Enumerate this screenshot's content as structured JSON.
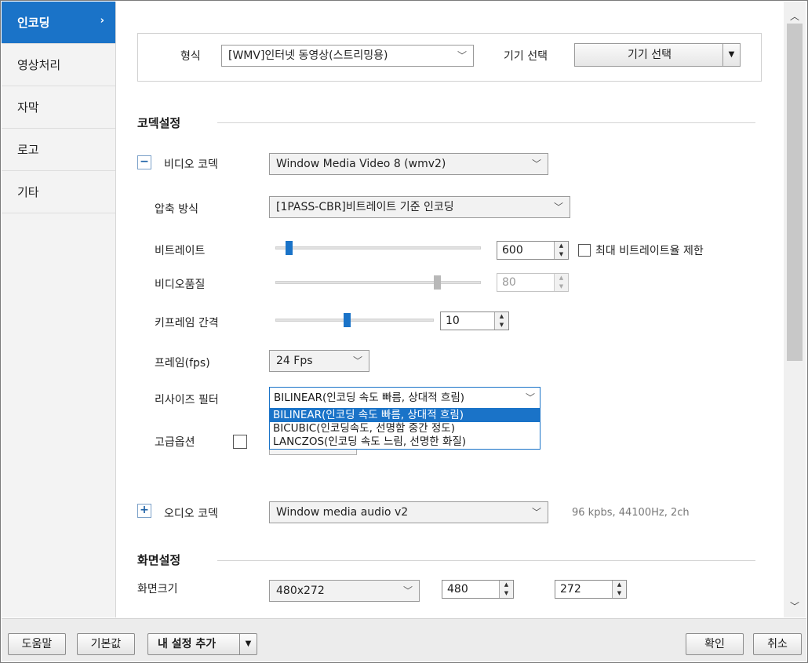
{
  "sidebar": {
    "items": [
      {
        "label": "인코딩",
        "active": true
      },
      {
        "label": "영상처리"
      },
      {
        "label": "자막"
      },
      {
        "label": "로고"
      },
      {
        "label": "기타"
      }
    ],
    "active_chevron": "›"
  },
  "format_row": {
    "format_label": "형식",
    "format_value": "[WMV]인터넷 동영상(스트리밍용)",
    "device_label": "기기 선택",
    "device_button": "기기 선택"
  },
  "codec": {
    "section_title": "코덱설정",
    "video_codec_label": "비디오 코덱",
    "video_codec_toggle": "−",
    "video_codec_value": "Window Media Video 8 (wmv2)",
    "compression_label": "압축 방식",
    "compression_value": "[1PASS-CBR]비트레이트 기준 인코딩",
    "bitrate_label": "비트레이트",
    "bitrate_value": "600",
    "bitrate_slider_fraction": 0.05,
    "max_bitrate_label": "최대 비트레이트율 제한",
    "quality_label": "비디오품질",
    "quality_value": "80",
    "quality_slider_fraction": 0.8,
    "keyframe_label": "키프레임 간격",
    "keyframe_value": "10",
    "keyframe_slider_fraction": 0.45,
    "fps_label": "프레임(fps)",
    "fps_value": "24 Fps",
    "resize_label": "리사이즈 필터",
    "resize_value": "BILINEAR(인코딩 속도 빠름, 상대적 흐림)",
    "resize_options": [
      "BILINEAR(인코딩 속도 빠름, 상대적 흐림)",
      "BICUBIC(인코딩속도, 선명함 중간 정도)",
      "LANCZOS(인코딩 속도 느림, 선명한 화질)"
    ],
    "advanced_label": "고급옵션",
    "audio_codec_label": "오디오 코덱",
    "audio_codec_toggle": "+",
    "audio_codec_value": "Window media audio v2",
    "audio_info": "96 kpbs, 44100Hz, 2ch"
  },
  "screen": {
    "section_title": "화면설정",
    "size_label": "화면크기",
    "size_value": "480x272",
    "width_value": "480",
    "height_value": "272"
  },
  "bottom": {
    "help": "도움말",
    "default": "기본값",
    "add_setting": "내 설정 추가",
    "ok": "확인",
    "cancel": "취소"
  },
  "colors": {
    "accent": "#1a73c8"
  }
}
